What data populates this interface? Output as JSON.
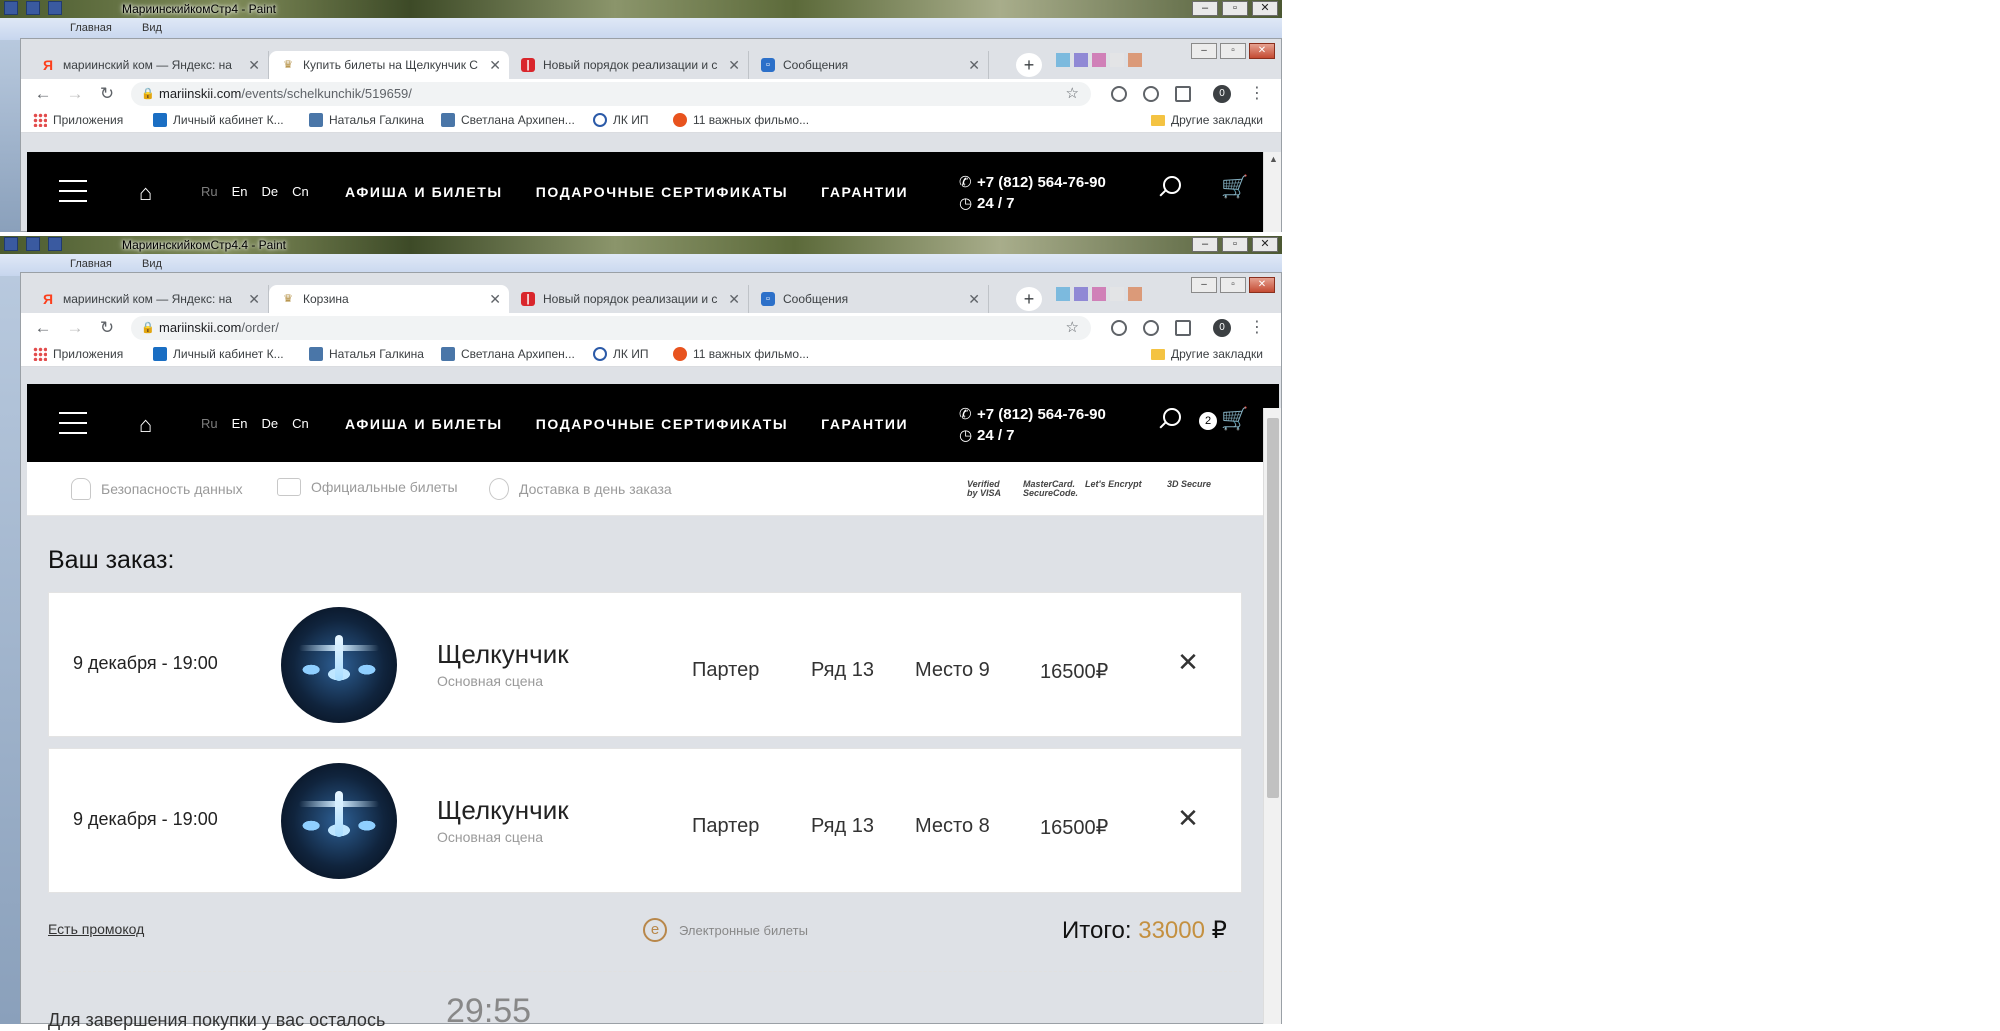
{
  "windows": [
    {
      "paint_title": "МариинскийкомСтр4 - Paint",
      "tabs": [
        {
          "icon": "yandex",
          "label": "мариинский ком — Яндекс: на"
        },
        {
          "icon": "theatre",
          "label": "Купить билеты на Щелкунчик С",
          "active": true
        },
        {
          "icon": "redbook",
          "label": "Новый порядок реализации и с"
        },
        {
          "icon": "msg",
          "label": "Сообщения"
        }
      ],
      "url_host": "mariinskii.com",
      "url_path": "/events/schelkunchik/519659/"
    },
    {
      "paint_title": "МариинскийкомСтр4.4 - Paint",
      "tabs": [
        {
          "icon": "yandex",
          "label": "мариинский ком — Яндекс: на"
        },
        {
          "icon": "theatre",
          "label": "Корзина",
          "active": true
        },
        {
          "icon": "redbook",
          "label": "Новый порядок реализации и с"
        },
        {
          "icon": "msg",
          "label": "Сообщения"
        }
      ],
      "url_host": "mariinskii.com",
      "url_path": "/order/"
    }
  ],
  "paint": {
    "ribbon_tab1": "Главная",
    "ribbon_tab2": "Вид"
  },
  "profile_count": "0",
  "bookmarks": {
    "apps": "Приложения",
    "items": [
      "Личный кабинет К...",
      "Наталья Галкина",
      "Светлана Архипен...",
      "ЛК ИП",
      "11 важных фильмо..."
    ],
    "other": "Другие закладки"
  },
  "site": {
    "languages": [
      "Ru",
      "En",
      "De",
      "Cn"
    ],
    "nav": [
      "АФИША И БИЛЕТЫ",
      "ПОДАРОЧНЫЕ СЕРТИФИКАТЫ",
      "ГАРАНТИИ"
    ],
    "phone": "+7 (812) 564-76-90",
    "hours": "24 / 7",
    "cart_count": "2"
  },
  "trust": {
    "items": [
      "Безопасность данных",
      "Официальные билеты",
      "Доставка в день заказа"
    ],
    "logos": [
      "Verified by VISA",
      "MasterCard. SecureCode.",
      "Let's Encrypt",
      "3D Secure"
    ]
  },
  "order": {
    "title": "Ваш заказ:",
    "items": [
      {
        "date": "9 декабря - 19:00",
        "name": "Щелкунчик",
        "venue": "Основная сцена",
        "sector": "Партер",
        "row": "Ряд 13",
        "seat": "Место 9",
        "price": "16500₽"
      },
      {
        "date": "9 декабря - 19:00",
        "name": "Щелкунчик",
        "venue": "Основная сцена",
        "sector": "Партер",
        "row": "Ряд 13",
        "seat": "Место 8",
        "price": "16500₽"
      }
    ],
    "promo_link": "Есть промокод",
    "eticket_icon": "е",
    "eticket_label": "Электронные билеты",
    "total_label": "Итого:",
    "total_value": "33000",
    "currency": "₽",
    "timer_label": "Для завершения покупки у вас осталось",
    "timer_value": "29:55"
  },
  "colors": {
    "accent_gold": "#c49040",
    "header_bg": "#000000"
  }
}
